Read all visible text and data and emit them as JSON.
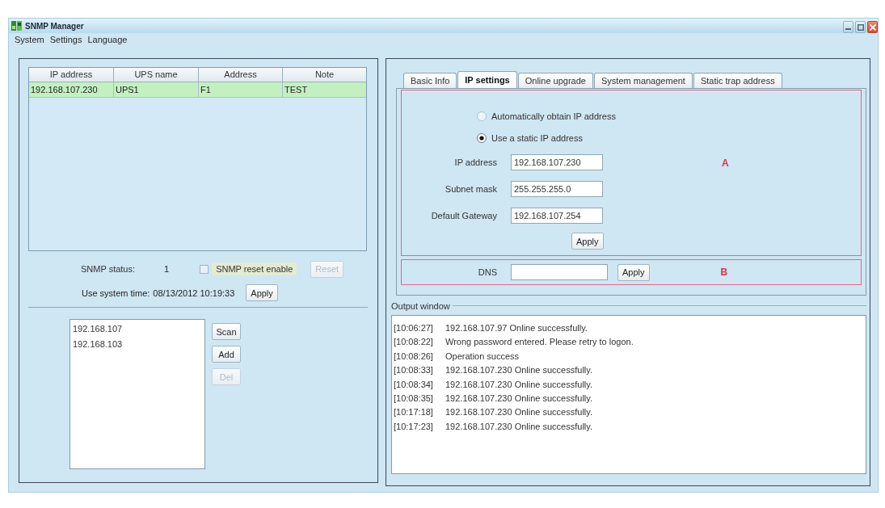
{
  "window": {
    "title": "SNMP Manager"
  },
  "menu": [
    "System",
    "Settings",
    "Language"
  ],
  "device_table": {
    "columns": [
      "IP address",
      "UPS name",
      "Address",
      "Note"
    ],
    "rows": [
      {
        "cells": [
          "192.168.107.230",
          "UPS1",
          "F1",
          "TEST"
        ],
        "selected": true
      }
    ]
  },
  "snmp_status": {
    "label": "SNMP status:",
    "value": "1"
  },
  "reset_enable": {
    "label": "SNMP reset enable",
    "checked": false
  },
  "reset_button": {
    "label": "Reset",
    "disabled": true
  },
  "system_time": {
    "label": "Use system time:",
    "value": "08/13/2012 10:19:33",
    "button": "Apply"
  },
  "segments": {
    "items": [
      {
        "label": "192.168.107",
        "selected": false
      },
      {
        "label": "192.168.103",
        "selected": false
      }
    ],
    "buttons": [
      {
        "label": "Scan",
        "disabled": false
      },
      {
        "label": "Add",
        "disabled": false
      },
      {
        "label": "Del",
        "disabled": true
      }
    ]
  },
  "tabs": [
    {
      "label": "Basic Info",
      "selected": false
    },
    {
      "label": "IP settings",
      "selected": true
    },
    {
      "label": "Online upgrade",
      "selected": false
    },
    {
      "label": "System management",
      "selected": false
    },
    {
      "label": "Static trap address",
      "selected": false
    }
  ],
  "ip_settings": {
    "marker": "A",
    "modes": [
      {
        "label": "Automatically obtain IP address",
        "selected": false
      },
      {
        "label": "Use a static IP address",
        "selected": true
      }
    ],
    "fields": [
      {
        "label": "IP address",
        "value": "192.168.107.230"
      },
      {
        "label": "Subnet mask",
        "value": "255.255.255.0"
      },
      {
        "label": "Default Gateway",
        "value": "192.168.107.254"
      }
    ],
    "apply": "Apply"
  },
  "dns": {
    "marker": "B",
    "label": "DNS",
    "apply": "Apply"
  },
  "output_window": {
    "title": "Output window",
    "lines": [
      {
        "time": "[10:06:27]",
        "message": "192.168.107.97 Online successfully."
      },
      {
        "time": "[10:08:22]",
        "message": "Wrong password entered. Please retry to logon."
      },
      {
        "time": "[10:08:26]",
        "message": "Operation success"
      },
      {
        "time": "[10:08:33]",
        "message": "192.168.107.230 Online successfully."
      },
      {
        "time": "[10:08:34]",
        "message": "192.168.107.230 Online successfully."
      },
      {
        "time": "[10:08:35]",
        "message": "192.168.107.230 Online successfully."
      },
      {
        "time": "[10:17:18]",
        "message": "192.168.107.230 Online successfully."
      },
      {
        "time": "[10:17:23]",
        "message": "192.168.107.230 Online successfully."
      }
    ]
  }
}
